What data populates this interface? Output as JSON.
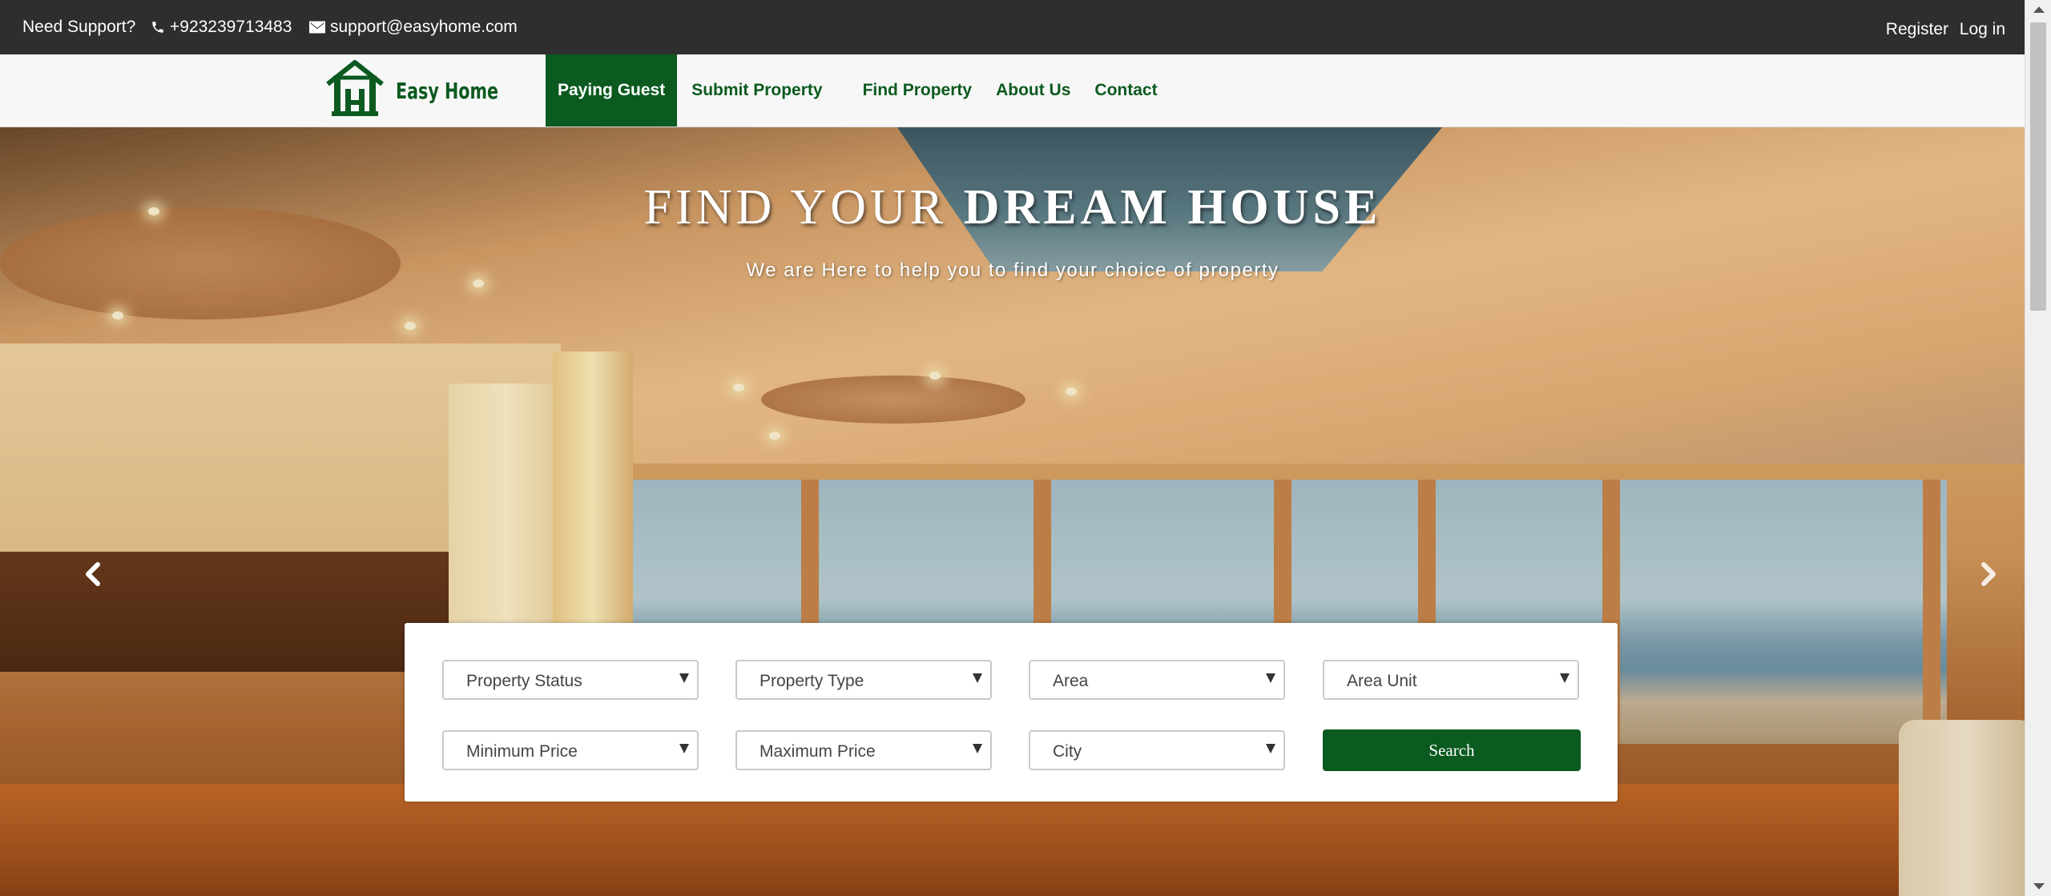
{
  "topbar": {
    "support_label": "Need Support?",
    "phone": "+923239713483",
    "email": "support@easyhome.com",
    "register_label": "Register",
    "login_label": "Log in",
    "phone_icon": "phone-icon",
    "email_icon": "envelope-icon"
  },
  "brand": {
    "name": "Easy Home",
    "logo_icon": "house-logo-icon",
    "color": "#0b5a1f"
  },
  "nav": {
    "items": [
      {
        "label": "Paying Guest",
        "active": true
      },
      {
        "label": "Submit Property",
        "active": false
      },
      {
        "label": "Find Property",
        "active": false
      },
      {
        "label": "About Us",
        "active": false
      },
      {
        "label": "Contact",
        "active": false
      }
    ]
  },
  "hero": {
    "title_light": "FIND YOUR ",
    "title_bold": "DREAM HOUSE",
    "subtitle": "We are Here to help you to find your choice of property",
    "prev_icon": "chevron-left-icon",
    "next_icon": "chevron-right-icon"
  },
  "search": {
    "property_status": "Property Status",
    "property_type": "Property Type",
    "area": "Area",
    "area_unit": "Area Unit",
    "min_price": "Minimum Price",
    "max_price": "Maximum Price",
    "city": "City",
    "button_label": "Search"
  }
}
